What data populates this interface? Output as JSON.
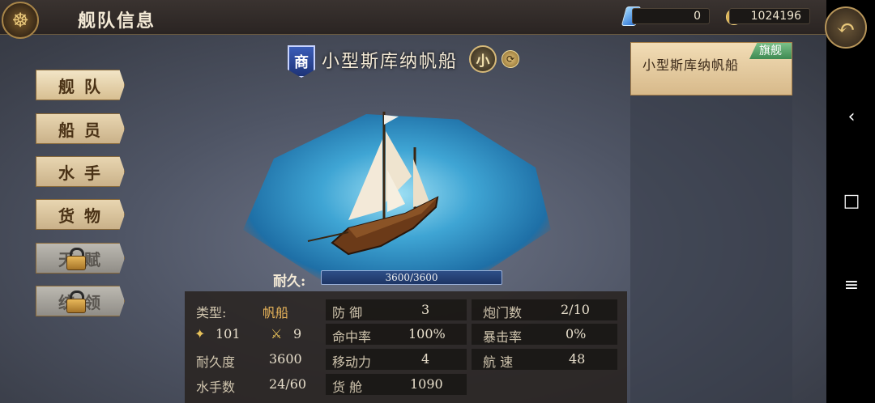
{
  "header": {
    "title": "舰队信息",
    "gems": "0",
    "gold": "1024196"
  },
  "nav": {
    "fleet": "舰队",
    "crew": "船员",
    "sailors": "水手",
    "cargo": "货物",
    "talent": "天赋",
    "command": "统领"
  },
  "ship": {
    "type_badge": "商",
    "name": "小型斯库纳帆船",
    "size_badge": "小",
    "durability_label": "耐久:",
    "durability_value": "3600/3600"
  },
  "stats": {
    "type_label": "类型:",
    "type_value": "帆船",
    "attack_value": "101",
    "swords_value": "9",
    "durability_label": "耐久度",
    "durability_value": "3600",
    "sailors_label": "水手数",
    "sailors_value": "24/60",
    "defense_label": "防  御",
    "defense_value": "3",
    "hit_label": "命中率",
    "hit_value": "100%",
    "move_label": "移动力",
    "move_value": "4",
    "cargo_label": "货  舱",
    "cargo_value": "1090",
    "cannon_label": "炮门数",
    "cannon_value": "2/10",
    "crit_label": "暴击率",
    "crit_value": "0%",
    "speed_label": "航  速",
    "speed_value": "48"
  },
  "flagship": {
    "name": "小型斯库纳帆船",
    "tag": "旗舰"
  },
  "icons": {
    "menu": "ship-wheel-icon",
    "back": "back-arrow-icon",
    "gem": "gem-icon",
    "gold": "gold-coin-icon"
  }
}
